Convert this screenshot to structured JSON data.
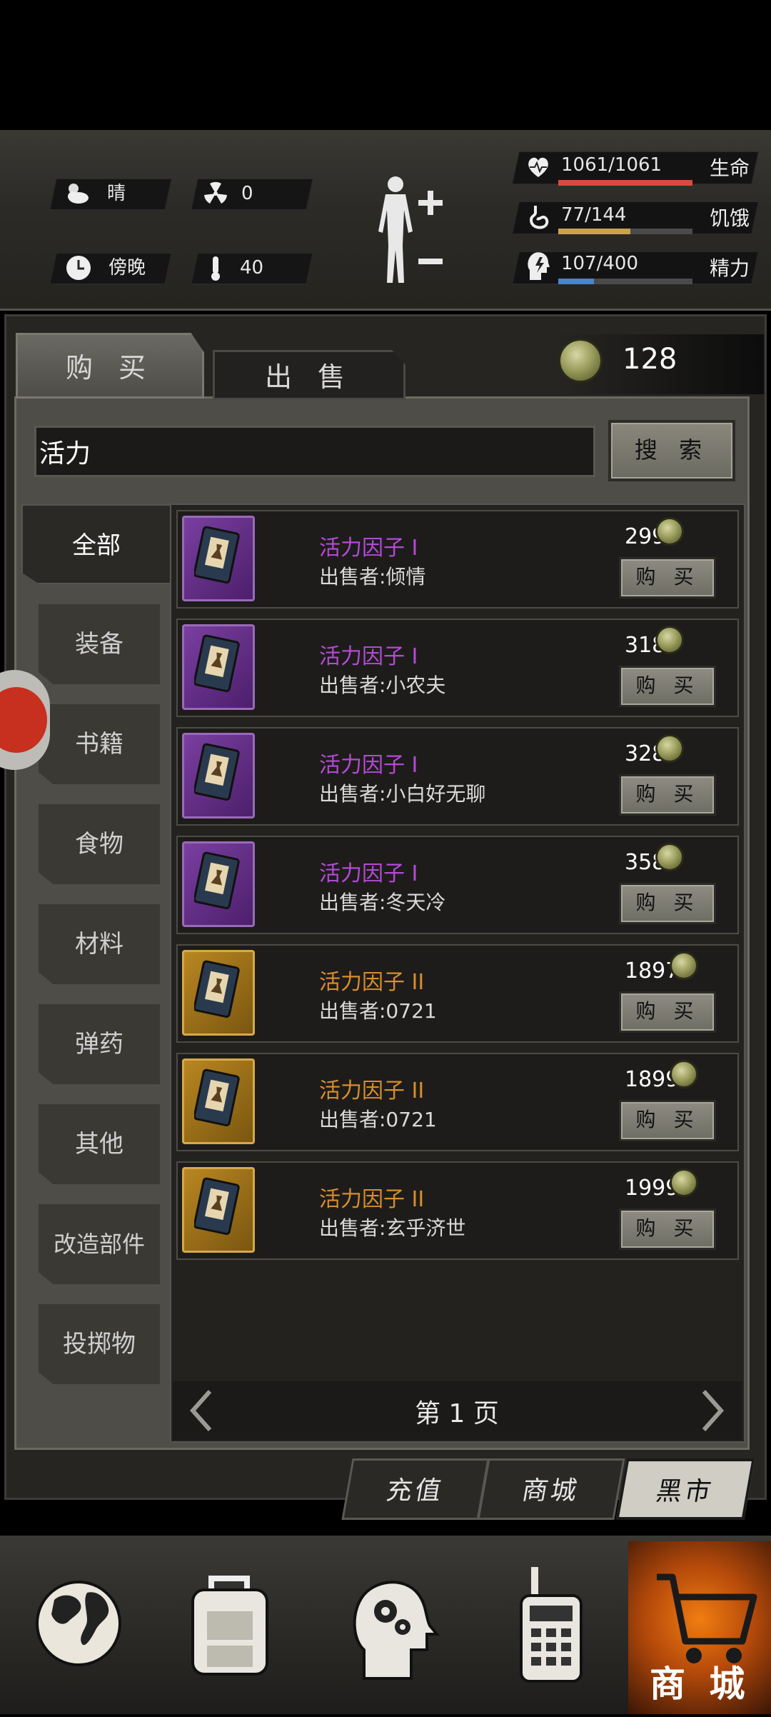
{
  "status": {
    "weather": "晴",
    "radiation": "0",
    "time_of_day": "傍晚",
    "temperature": "40",
    "health": {
      "value": "1061/1061",
      "label": "生命",
      "fill": 1.0,
      "color": "#d94a3e"
    },
    "hunger": {
      "value": "77/144",
      "label": "饥饿",
      "fill": 0.535,
      "color": "#c9a24a"
    },
    "energy": {
      "value": "107/400",
      "label": "精力",
      "fill": 0.2675,
      "color": "#4a84c9"
    },
    "icons": [
      "cloud-sun-icon",
      "radiation-icon",
      "clock-icon",
      "thermometer-icon",
      "heart-icon",
      "stomach-icon",
      "energy-head-icon",
      "body-figure-icon"
    ]
  },
  "tabs": {
    "buy": "购 买",
    "sell": "出 售"
  },
  "currency": {
    "amount": "128",
    "icon": "bottle-cap-coin-icon"
  },
  "search": {
    "value": "活力",
    "button": "搜 索"
  },
  "categories": [
    "全部",
    "装备",
    "书籍",
    "食物",
    "材料",
    "弹药",
    "其他",
    "改造部件",
    "投掷物"
  ],
  "listings": [
    {
      "name": "活力因子 I",
      "seller": "出售者:倾情",
      "price": "299",
      "rarity": "purple",
      "button": "购 买"
    },
    {
      "name": "活力因子 I",
      "seller": "出售者:小农夫",
      "price": "318",
      "rarity": "purple",
      "button": "购 买"
    },
    {
      "name": "活力因子 I",
      "seller": "出售者:小白好无聊",
      "price": "328",
      "rarity": "purple",
      "button": "购 买"
    },
    {
      "name": "活力因子 I",
      "seller": "出售者:冬天冷",
      "price": "358",
      "rarity": "purple",
      "button": "购 买"
    },
    {
      "name": "活力因子 II",
      "seller": "出售者:0721",
      "price": "1897",
      "rarity": "gold",
      "button": "购 买"
    },
    {
      "name": "活力因子 II",
      "seller": "出售者:0721",
      "price": "1899",
      "rarity": "gold",
      "button": "购 买"
    },
    {
      "name": "活力因子 II",
      "seller": "出售者:玄乎济世",
      "price": "1999",
      "rarity": "gold",
      "button": "购 买"
    }
  ],
  "pagination": {
    "label": "第 1 页"
  },
  "bottom_tabs": {
    "recharge": "充值",
    "mall": "商城",
    "black_market": "黑市"
  },
  "nav": {
    "shop": "商 城",
    "icons": [
      "globe-icon",
      "backpack-icon",
      "head-gears-icon",
      "radio-icon",
      "shopping-cart-icon"
    ]
  }
}
